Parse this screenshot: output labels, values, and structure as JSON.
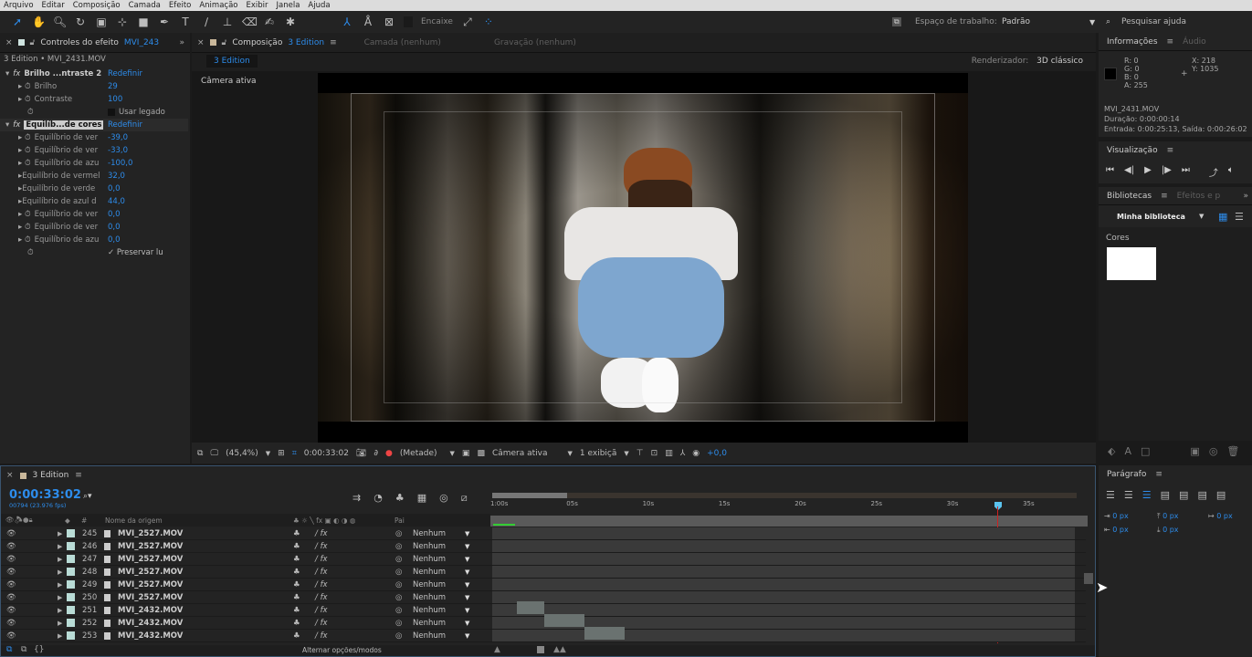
{
  "menu": [
    "Arquivo",
    "Editar",
    "Composição",
    "Camada",
    "Efeito",
    "Animação",
    "Exibir",
    "Janela",
    "Ajuda"
  ],
  "toolbar": {
    "snap_label": "Encaixe",
    "workspace_label": "Espaço de trabalho:",
    "workspace_value": "Padrão",
    "search_help": "Pesquisar ajuda"
  },
  "effects_panel": {
    "title": "Controles do efeito",
    "title_layer": "MVI_243",
    "breadcrumb": "3 Edition • MVI_2431.MOV",
    "effects": [
      {
        "name": "Brilho ...ntraste 2",
        "reset": "Redefinir"
      },
      {
        "name": "Equilíb...de cores",
        "reset": "Redefinir"
      }
    ],
    "params": [
      {
        "label": "Brilho",
        "value": "29"
      },
      {
        "label": "Contraste",
        "value": "100"
      },
      {
        "label": "",
        "value": "Usar legado"
      },
      {
        "label": "Equilíbrio de ver",
        "value": "-39,0"
      },
      {
        "label": "Equilíbrio de ver",
        "value": "-33,0"
      },
      {
        "label": "Equilíbrio de azu",
        "value": "-100,0"
      },
      {
        "label": "Equilíbrio de vermel",
        "value": "32,0"
      },
      {
        "label": "Equilíbrio de verde",
        "value": "0,0"
      },
      {
        "label": "Equilíbrio de azul d",
        "value": "44,0"
      },
      {
        "label": "Equilíbrio de ver",
        "value": "0,0"
      },
      {
        "label": "Equilíbrio de ver",
        "value": "0,0"
      },
      {
        "label": "Equilíbrio de azu",
        "value": "0,0"
      },
      {
        "label": "",
        "value": "✓ Preservar lu"
      }
    ]
  },
  "comp_panel": {
    "title": "Composição",
    "comp_name": "3 Edition",
    "tab_layer": "Camada (nenhum)",
    "tab_footage": "Gravação (nenhum)",
    "subtab": "3 Edition",
    "renderer_label": "Renderizador:",
    "renderer_value": "3D clássico",
    "camera_label": "Câmera ativa",
    "footer": {
      "zoom": "(45,4%)",
      "time": "0:00:33:02",
      "resolution": "(Metade)",
      "camera": "Câmera ativa",
      "views": "1 exibiçã",
      "exposure": "+0,0"
    }
  },
  "info_panel": {
    "tab": "Informações",
    "tab2": "Áudio",
    "r": "R: 0",
    "g": "G: 0",
    "b": "B: 0",
    "a": "A: 255",
    "x": "X: 218",
    "y": "Y: 1035",
    "file": "MVI_2431.MOV",
    "duration": "Duração: 0:00:00:14",
    "inout": "Entrada: 0:00:25:13, Saída: 0:00:26:02"
  },
  "preview_panel": {
    "title": "Visualização"
  },
  "libraries_panel": {
    "tab": "Bibliotecas",
    "tab2": "Efeitos e p",
    "library": "Minha biblioteca",
    "colors_label": "Cores",
    "swatch": "#ffffff"
  },
  "paragraph_panel": {
    "title": "Parágrafo",
    "values": [
      "0 px",
      "0 px",
      "0 px",
      "0 px",
      "0 px"
    ]
  },
  "timeline": {
    "tab": "3 Edition",
    "timecode": "0:00:33:02",
    "frames": "00794 (23.976 fps)",
    "col_name": "Nome da origem",
    "col_num": "#",
    "col_parent": "Pai",
    "ruler": [
      "1:00s",
      "05s",
      "10s",
      "15s",
      "20s",
      "25s",
      "30s",
      "35s"
    ],
    "footer": "Alternar opções/modos",
    "layers": [
      {
        "num": "245",
        "name": "MVI_2527.MOV",
        "parent": "Nenhum"
      },
      {
        "num": "246",
        "name": "MVI_2527.MOV",
        "parent": "Nenhum"
      },
      {
        "num": "247",
        "name": "MVI_2527.MOV",
        "parent": "Nenhum"
      },
      {
        "num": "248",
        "name": "MVI_2527.MOV",
        "parent": "Nenhum"
      },
      {
        "num": "249",
        "name": "MVI_2527.MOV",
        "parent": "Nenhum"
      },
      {
        "num": "250",
        "name": "MVI_2527.MOV",
        "parent": "Nenhum"
      },
      {
        "num": "251",
        "name": "MVI_2432.MOV",
        "parent": "Nenhum"
      },
      {
        "num": "252",
        "name": "MVI_2432.MOV",
        "parent": "Nenhum"
      },
      {
        "num": "253",
        "name": "MVI_2432.MOV",
        "parent": "Nenhum"
      }
    ]
  }
}
